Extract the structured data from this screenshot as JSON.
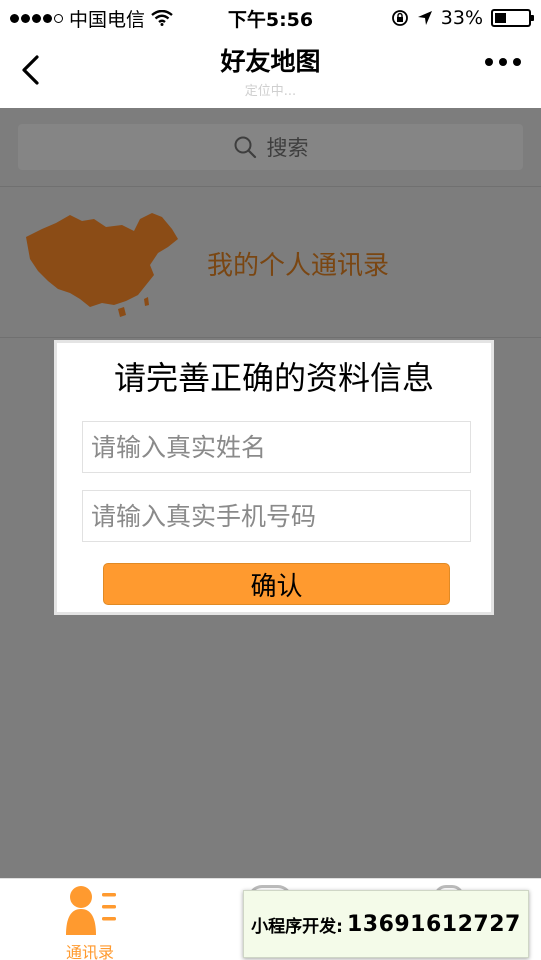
{
  "status_bar": {
    "carrier": "中国电信",
    "time": "下午5:56",
    "battery_percent": "33%",
    "battery_level": 0.33
  },
  "nav": {
    "title": "好友地图",
    "subtitle": "定位中..."
  },
  "search": {
    "placeholder": "搜索"
  },
  "contacts_entry": {
    "label": "我的个人通讯录"
  },
  "modal": {
    "title": "请完善正确的资料信息",
    "name_placeholder": "请输入真实姓名",
    "name_value": "",
    "phone_placeholder": "请输入真实手机号码",
    "phone_value": "",
    "confirm_label": "确认"
  },
  "tab_bar": {
    "tabs": [
      {
        "label": "通讯录",
        "icon": "contacts-icon",
        "active": true
      }
    ]
  },
  "promo": {
    "label": "小程序开发:",
    "number": "13691612727"
  },
  "colors": {
    "accent": "#ff9a2f",
    "map_brown": "#8b4c16",
    "overlay_gray": "#7d7d7d"
  }
}
